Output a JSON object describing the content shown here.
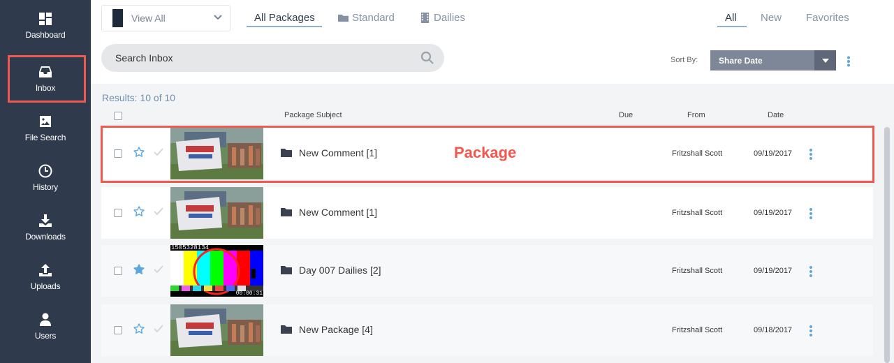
{
  "sidebar": {
    "items": [
      {
        "label": "Dashboard",
        "icon": "dashboard-icon"
      },
      {
        "label": "Inbox",
        "icon": "inbox-icon"
      },
      {
        "label": "File Search",
        "icon": "image-icon"
      },
      {
        "label": "History",
        "icon": "clock-icon"
      },
      {
        "label": "Downloads",
        "icon": "download-icon"
      },
      {
        "label": "Uploads",
        "icon": "upload-icon"
      },
      {
        "label": "Users",
        "icon": "user-icon"
      }
    ]
  },
  "toolbar": {
    "view_select": "View All",
    "tabs": [
      "All Packages",
      "Standard",
      "Dailies"
    ],
    "filters": [
      "All",
      "New",
      "Favorites"
    ],
    "search_placeholder": "Search Inbox",
    "sort_label": "Sort By:",
    "sort_value": "Share Date"
  },
  "results": "Results: 10 of 10",
  "columns": {
    "subject": "Package Subject",
    "due": "Due",
    "from": "From",
    "date": "Date"
  },
  "rows": [
    {
      "subject": "New Comment [1]",
      "from": "Fritzshall Scott",
      "date": "09/19/2017",
      "favorite": false,
      "thumb": "banner-photo"
    },
    {
      "subject": "New Comment [1]",
      "from": "Fritzshall Scott",
      "date": "09/19/2017",
      "favorite": false,
      "thumb": "banner-photo"
    },
    {
      "subject": "Day 007 Dailies [2]",
      "from": "Fritzshall Scott",
      "date": "09/19/2017",
      "favorite": true,
      "thumb": "color-bars",
      "thumb_top_text": "1505328134",
      "thumb_timecode": "00:00:31"
    },
    {
      "subject": "New Package [4]",
      "from": "Fritzshall Scott",
      "date": "09/18/2017",
      "favorite": false,
      "thumb": "banner-photo"
    }
  ],
  "annotations": {
    "inbox": "Inbox",
    "package": "Package"
  },
  "colors": {
    "sidebar": "#2f3b4d",
    "highlight": "#f0594f",
    "accent": "#5ea7dd"
  }
}
